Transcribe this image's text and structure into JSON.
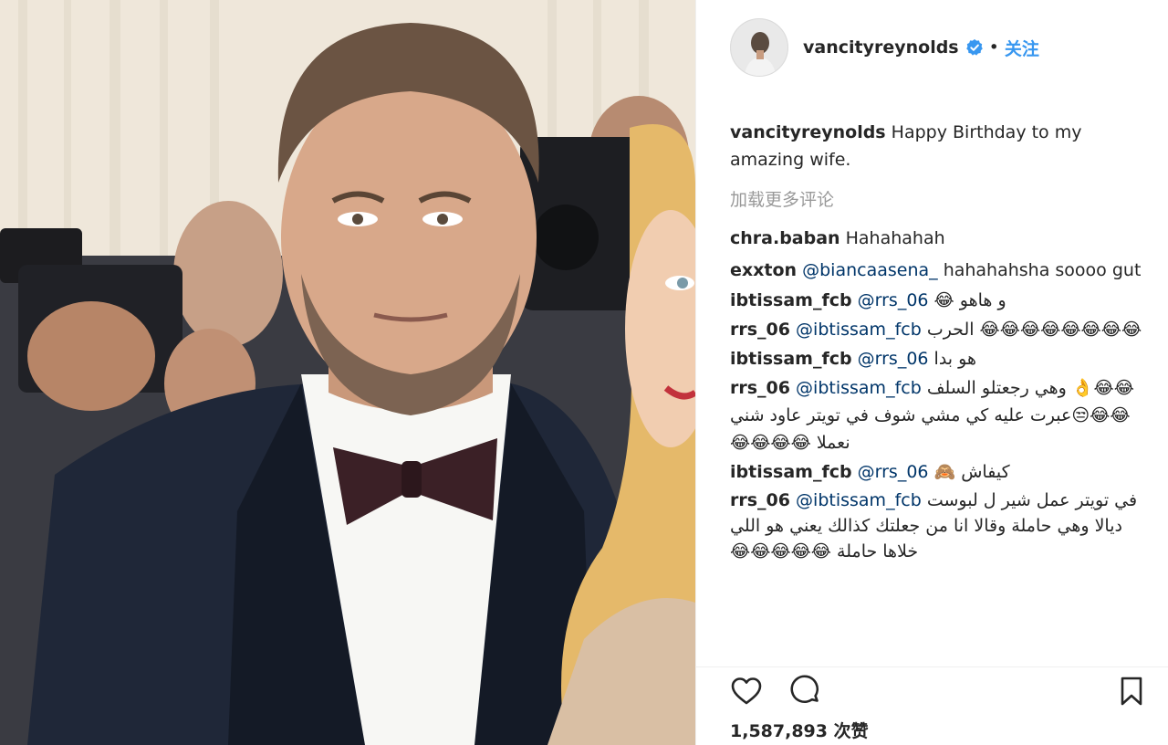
{
  "post": {
    "username": "vancityreynolds",
    "separator": "•",
    "follow_label": "关注",
    "caption_text": "Happy Birthday to my amazing wife.",
    "load_more_label": "加载更多评论",
    "likes_text": "1,587,893 次赞"
  },
  "comments": [
    {
      "user": "chra.baban",
      "mention": "",
      "text": "Hahahahah"
    },
    {
      "user": "exxton",
      "mention": "@biancaasena_",
      "text": "hahahahsha soooo gut"
    },
    {
      "user": "ibtissam_fcb",
      "mention": "@rrs_06",
      "text": "و هاهو 😂"
    },
    {
      "user": "rrs_06",
      "mention": "@ibtissam_fcb",
      "text": "😂😂😂😂😂😂😂😂 الحرب"
    },
    {
      "user": "ibtissam_fcb",
      "mention": "@rrs_06",
      "text": "هو بدا"
    },
    {
      "user": "rrs_06",
      "mention": "@ibtissam_fcb",
      "text": "😂😂👌 وهي رجعتلو السلف 😂😂😒عبرت عليه كي مشي شوف في تويتر عاود شني نعملا 😂😂😂😂"
    },
    {
      "user": "ibtissam_fcb",
      "mention": "@rrs_06",
      "text": "كيفاش 🙈"
    },
    {
      "user": "rrs_06",
      "mention": "@ibtissam_fcb",
      "text": "في تويتر عمل شير ل لبوست ديالا وهي حاملة وقالا انا من جعلتك كذالك يعني هو اللي خلاها حاملة 😂😂😂😂😂"
    }
  ],
  "icons": {
    "heart": "heart-icon",
    "comment": "comment-icon",
    "bookmark": "bookmark-icon",
    "verified": "verified-badge-icon"
  },
  "colors": {
    "verified_blue": "#3897f0",
    "link_blue": "#003569",
    "muted": "#999999",
    "text": "#262626"
  }
}
